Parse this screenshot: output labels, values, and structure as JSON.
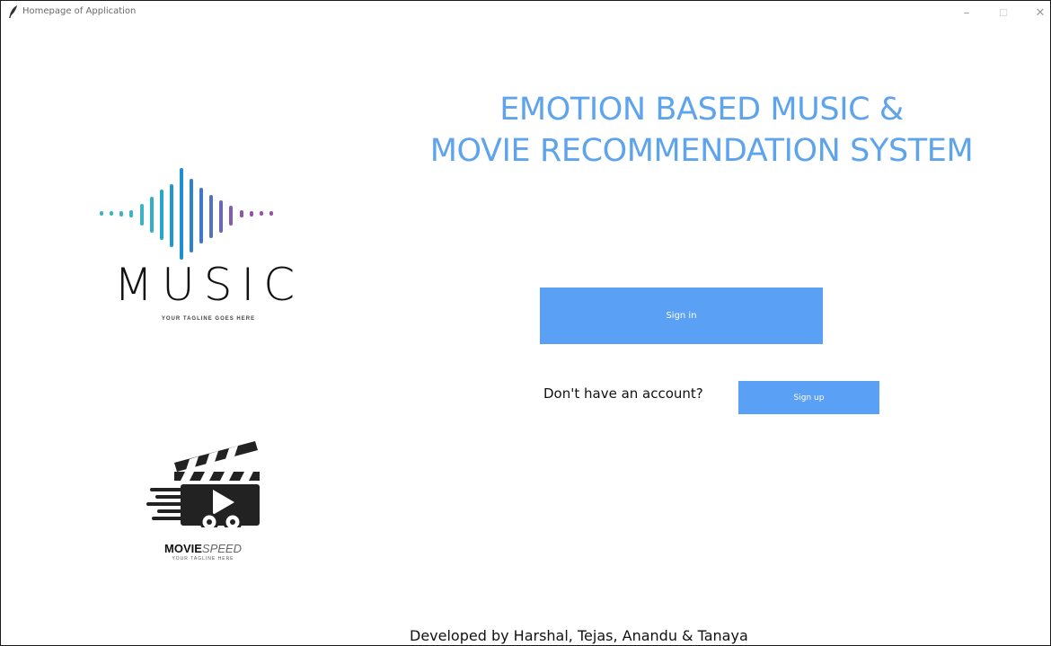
{
  "window": {
    "title": "Homepage of Application",
    "minimize": "–",
    "maximize": "☐",
    "close": "✕"
  },
  "headline": {
    "line1": "EMOTION BASED MUSIC &",
    "line2": "MOVIE RECOMMENDATION SYSTEM"
  },
  "auth": {
    "signin_label": "Sign in",
    "no_account_text": "Don't have an account?",
    "signup_label": "Sign up"
  },
  "logos": {
    "music_word": "MUSIC",
    "music_tagline": "YOUR TAGLINE GOES HERE",
    "movie_word_bold": "MOVIE",
    "movie_word_light": "SPEED",
    "movie_tagline": "YOUR TAGLINE HERE"
  },
  "footer": {
    "credits": "Developed by Harshal, Tejas, Anandu & Tanaya"
  },
  "colors": {
    "accent": "#5aa0f5",
    "headline": "#5ea4ec"
  }
}
